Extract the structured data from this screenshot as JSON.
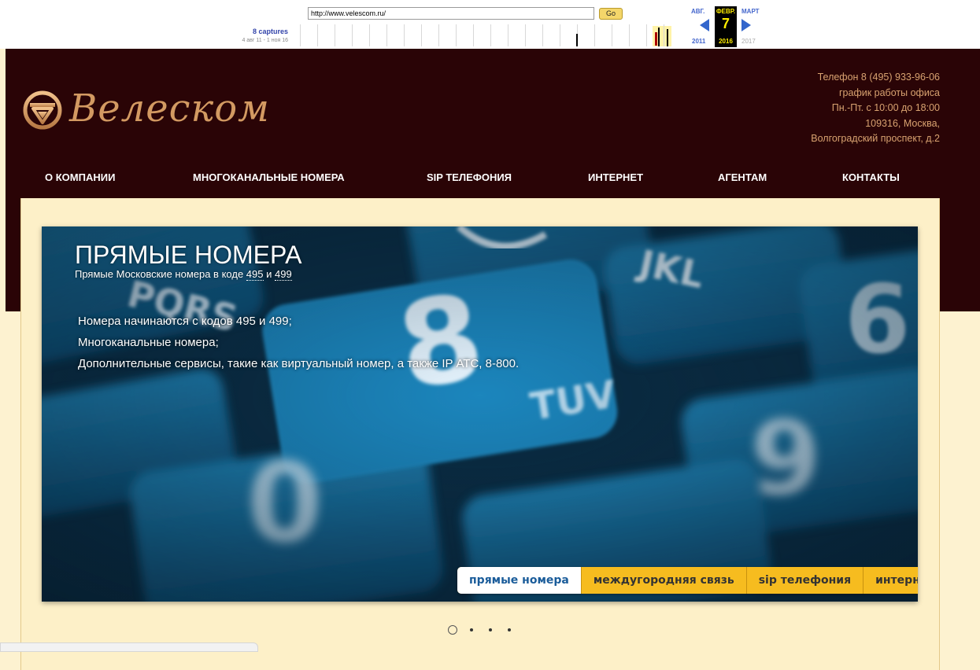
{
  "wayback": {
    "url": "http://www.velescom.ru/",
    "go_label": "Go",
    "captures_label": "8 captures",
    "range_label": "4 авг 11 - 1 ноя 16",
    "months": {
      "prev": "АВГ.",
      "current": "ФЕВР.",
      "next": "МАРТ"
    },
    "day": "7",
    "years": {
      "prev": "2011",
      "current": "2016",
      "next": "2017"
    }
  },
  "site": {
    "logo_text": "Велеском",
    "brand_color": "#d39a62",
    "header_bg": "#2a0406",
    "contacts": [
      "Телефон 8 (495) 933-96-06",
      "график работы офиса",
      "Пн.-Пт. с 10:00 до 18:00",
      "109316, Москва,",
      "Волгоградский проспект, д.2"
    ],
    "nav": [
      "О КОМПАНИИ",
      "МНОГОКАНАЛЬНЫЕ НОМЕРА",
      "SIP ТЕЛЕФОНИЯ",
      "ИНТЕРНЕТ",
      "АГЕНТАМ",
      "КОНТАКТЫ"
    ]
  },
  "slider": {
    "title": "ПРЯМЫЕ НОМЕРА",
    "subtitle_prefix": "Прямые Московские номера в коде ",
    "subtitle_code1": "495",
    "subtitle_and": " и ",
    "subtitle_code2": "499",
    "lines": [
      "Номера начинаются с кодов 495 и 499;",
      "Многоканальные номера;",
      "Дополнительные сервисы, такие как виртуальный номер, а также IP АТС, 8-800."
    ],
    "tabs": [
      "прямые номера",
      "междугородняя связь",
      "sip телефония",
      "интернет"
    ],
    "active_tab": 0,
    "slide_count": 4,
    "active_slide": 0,
    "tab_color": "#f6bc1f",
    "active_tab_text_color": "#1a5c9a"
  }
}
